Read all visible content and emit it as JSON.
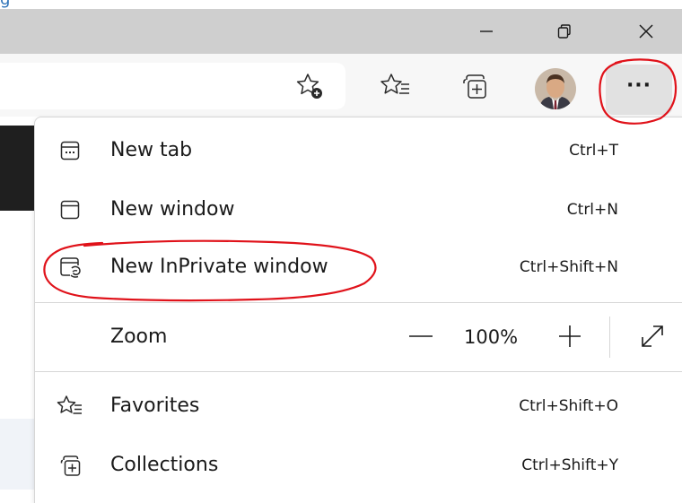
{
  "page_header": {
    "partial_text": "g"
  },
  "menu": {
    "items": [
      {
        "label": "New tab",
        "shortcut": "Ctrl+T",
        "icon": "new-tab-icon"
      },
      {
        "label": "New window",
        "shortcut": "Ctrl+N",
        "icon": "new-window-icon"
      },
      {
        "label": "New InPrivate window",
        "shortcut": "Ctrl+Shift+N",
        "icon": "inprivate-icon"
      },
      {
        "label": "Favorites",
        "shortcut": "Ctrl+Shift+O",
        "icon": "favorites-icon"
      },
      {
        "label": "Collections",
        "shortcut": "Ctrl+Shift+Y",
        "icon": "collections-icon"
      }
    ],
    "zoom": {
      "label": "Zoom",
      "value": "100%"
    }
  },
  "colors": {
    "titlebar": "#cfcfcf",
    "toolbar": "#f7f7f7",
    "annotation": "#e0121a",
    "link_blue": "#2f73b8"
  },
  "icons": [
    "minimize-icon",
    "restore-icon",
    "close-icon",
    "add-favorite-icon",
    "favorites-icon",
    "collections-icon",
    "more-icon",
    "zoom-out-icon",
    "zoom-in-icon",
    "fullscreen-icon"
  ]
}
